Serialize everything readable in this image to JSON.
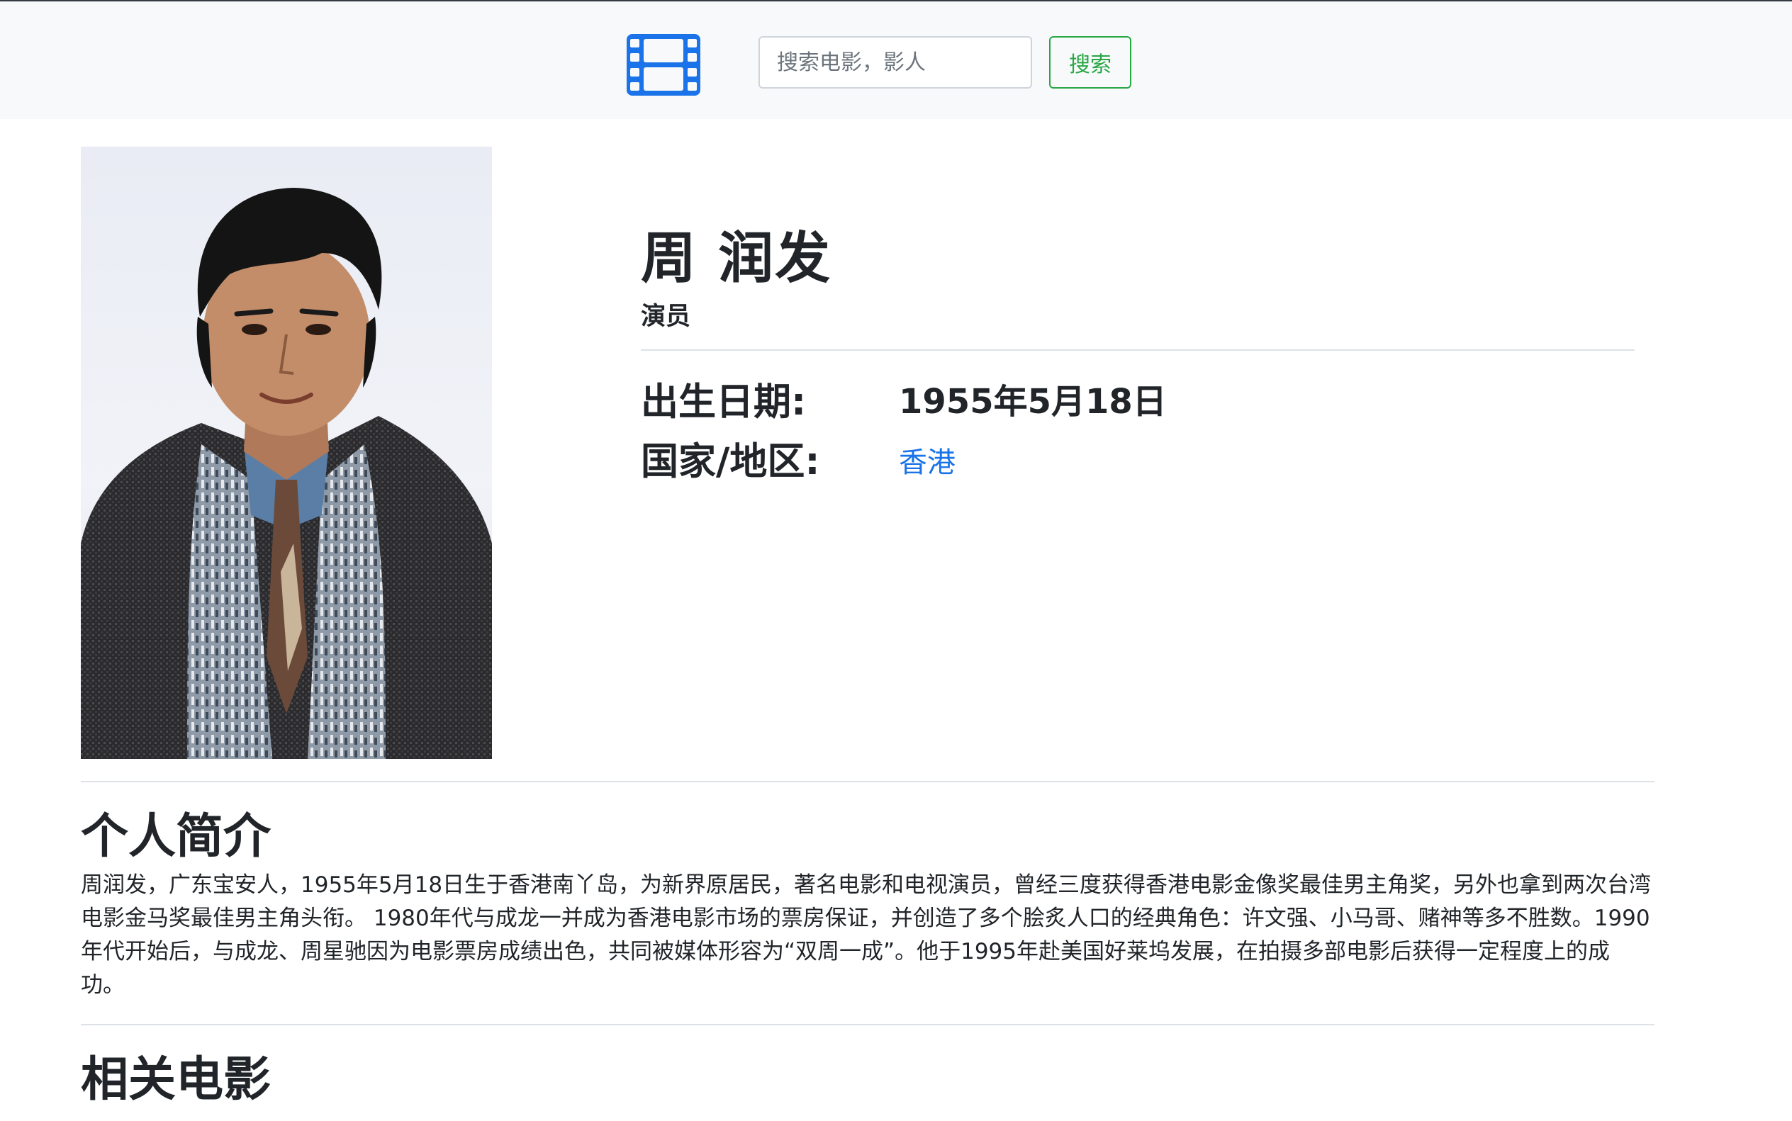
{
  "navbar": {
    "logo_icon": "film-icon",
    "search_placeholder": "搜索电影，影人",
    "search_button_label": "搜索"
  },
  "colors": {
    "accent_blue": "#1a73e8",
    "search_green": "#28a745",
    "navbar_bg": "#f8f9fa"
  },
  "person": {
    "name": "周 润发",
    "role": "演员",
    "birth_label": "出生日期:",
    "birth_value": "1955年5月18日",
    "region_label": "国家/地区:",
    "region_value": "香港"
  },
  "bio": {
    "heading": "个人简介",
    "text": "周润发，广东宝安人，1955年5月18日生于香港南丫岛，为新界原居民，著名电影和电视演员，曾经三度获得香港电影金像奖最佳男主角奖，另外也拿到两次台湾电影金马奖最佳男主角头衔。 1980年代与成龙一并成为香港电影市场的票房保证，并创造了多个脍炙人口的经典角色：许文强、小马哥、赌神等多不胜数。1990年代开始后，与成龙、周星驰因为电影票房成绩出色，共同被媒体形容为“双周一成”。他于1995年赴美国好莱坞发展，在拍摄多部电影后获得一定程度上的成功。"
  },
  "films": {
    "heading": "相关电影"
  }
}
